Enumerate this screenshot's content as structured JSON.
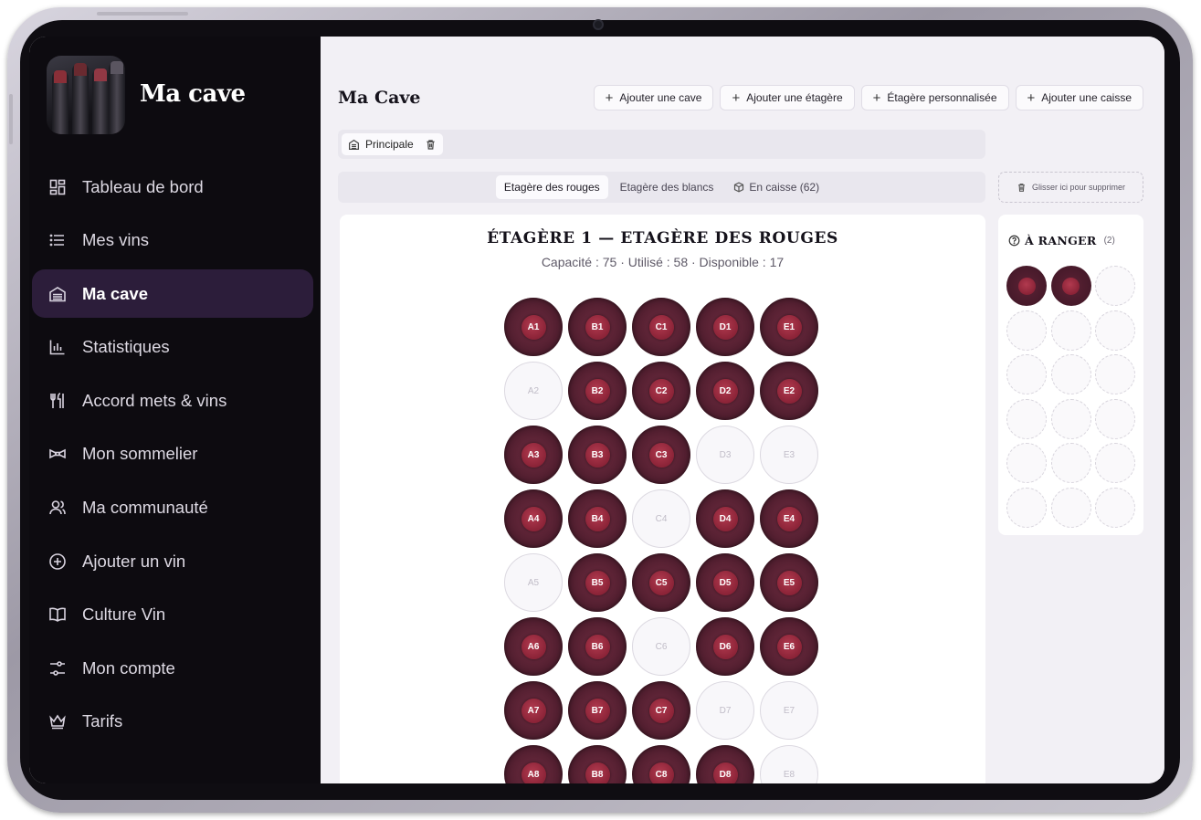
{
  "app": {
    "brand": "Ma cave"
  },
  "sidebar": {
    "items": [
      {
        "label": "Tableau de bord",
        "icon": "dashboard-icon"
      },
      {
        "label": "Mes vins",
        "icon": "list-icon"
      },
      {
        "label": "Ma cave",
        "icon": "cellar-icon",
        "active": true
      },
      {
        "label": "Statistiques",
        "icon": "chart-icon"
      },
      {
        "label": "Accord mets & vins",
        "icon": "utensils-icon"
      },
      {
        "label": "Mon sommelier",
        "icon": "bowtie-icon"
      },
      {
        "label": "Ma communauté",
        "icon": "users-icon"
      },
      {
        "label": "Ajouter un vin",
        "icon": "plus-circle-icon"
      },
      {
        "label": "Culture Vin",
        "icon": "book-icon"
      },
      {
        "label": "Mon compte",
        "icon": "settings-sliders-icon"
      },
      {
        "label": "Tarifs",
        "icon": "crown-icon"
      }
    ]
  },
  "header": {
    "title": "Ma Cave",
    "actions": [
      {
        "label": "Ajouter une cave"
      },
      {
        "label": "Ajouter une étagère"
      },
      {
        "label": "Étagère personnalisée"
      },
      {
        "label": "Ajouter une caisse"
      }
    ]
  },
  "caves": {
    "tabs": [
      {
        "label": "Principale"
      }
    ]
  },
  "shelf_tabs": [
    {
      "label": "Etagère des rouges",
      "active": true
    },
    {
      "label": "Etagère des blancs"
    },
    {
      "label": "En caisse (62)"
    }
  ],
  "drop_zone": {
    "label": "Glisser ici pour supprimer"
  },
  "shelf": {
    "title": "ÉTAGÈRE 1 — ETAGÈRE DES ROUGES",
    "subtitle": "Capacité : 75 · Utilisé : 58 · Disponible : 17",
    "slots": [
      {
        "id": "A1",
        "filled": true
      },
      {
        "id": "B1",
        "filled": true
      },
      {
        "id": "C1",
        "filled": true
      },
      {
        "id": "D1",
        "filled": true
      },
      {
        "id": "E1",
        "filled": true
      },
      {
        "id": "A2",
        "filled": false
      },
      {
        "id": "B2",
        "filled": true
      },
      {
        "id": "C2",
        "filled": true
      },
      {
        "id": "D2",
        "filled": true
      },
      {
        "id": "E2",
        "filled": true
      },
      {
        "id": "A3",
        "filled": true
      },
      {
        "id": "B3",
        "filled": true
      },
      {
        "id": "C3",
        "filled": true
      },
      {
        "id": "D3",
        "filled": false
      },
      {
        "id": "E3",
        "filled": false
      },
      {
        "id": "A4",
        "filled": true
      },
      {
        "id": "B4",
        "filled": true
      },
      {
        "id": "C4",
        "filled": false
      },
      {
        "id": "D4",
        "filled": true
      },
      {
        "id": "E4",
        "filled": true
      },
      {
        "id": "A5",
        "filled": false
      },
      {
        "id": "B5",
        "filled": true
      },
      {
        "id": "C5",
        "filled": true
      },
      {
        "id": "D5",
        "filled": true
      },
      {
        "id": "E5",
        "filled": true
      },
      {
        "id": "A6",
        "filled": true
      },
      {
        "id": "B6",
        "filled": true
      },
      {
        "id": "C6",
        "filled": false
      },
      {
        "id": "D6",
        "filled": true
      },
      {
        "id": "E6",
        "filled": true
      },
      {
        "id": "A7",
        "filled": true
      },
      {
        "id": "B7",
        "filled": true
      },
      {
        "id": "C7",
        "filled": true
      },
      {
        "id": "D7",
        "filled": false
      },
      {
        "id": "E7",
        "filled": false
      },
      {
        "id": "A8",
        "filled": true
      },
      {
        "id": "B8",
        "filled": true
      },
      {
        "id": "C8",
        "filled": true
      },
      {
        "id": "D8",
        "filled": true
      },
      {
        "id": "E8",
        "filled": false
      }
    ]
  },
  "to_store": {
    "title": "À RANGER",
    "count": "(2)",
    "slots": [
      true,
      true,
      false,
      false,
      false,
      false,
      false,
      false,
      false,
      false,
      false,
      false,
      false,
      false,
      false,
      false,
      false,
      false
    ]
  },
  "colors": {
    "wine": "#8b2337",
    "sidebar_bg": "#0d0b10",
    "active_nav": "#2c1d3a"
  }
}
